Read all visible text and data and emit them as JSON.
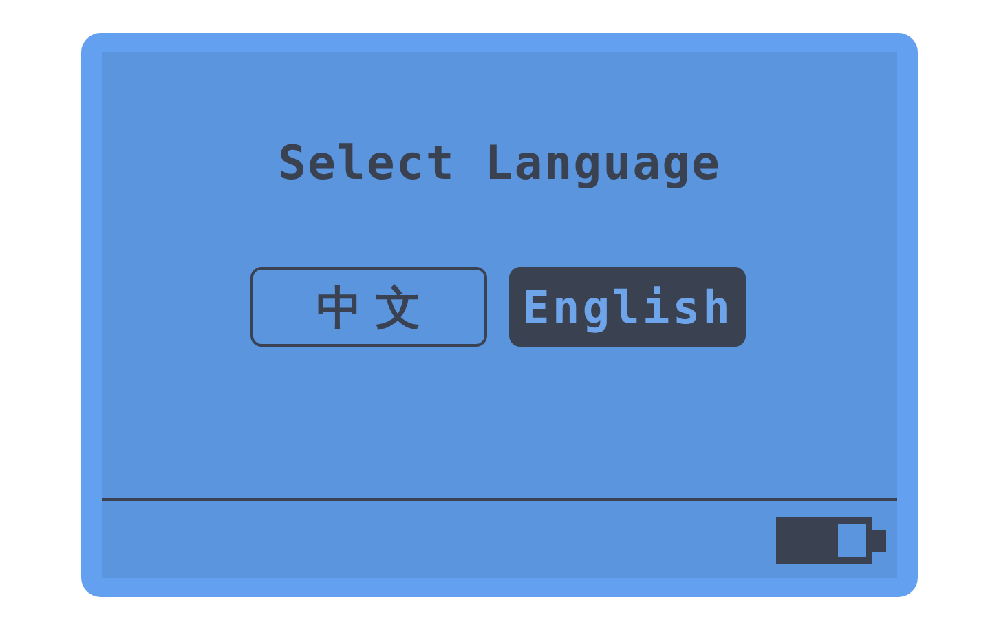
{
  "title": "Select Language",
  "options": [
    {
      "label": "中文",
      "selected": false
    },
    {
      "label": "English",
      "selected": true
    }
  ]
}
